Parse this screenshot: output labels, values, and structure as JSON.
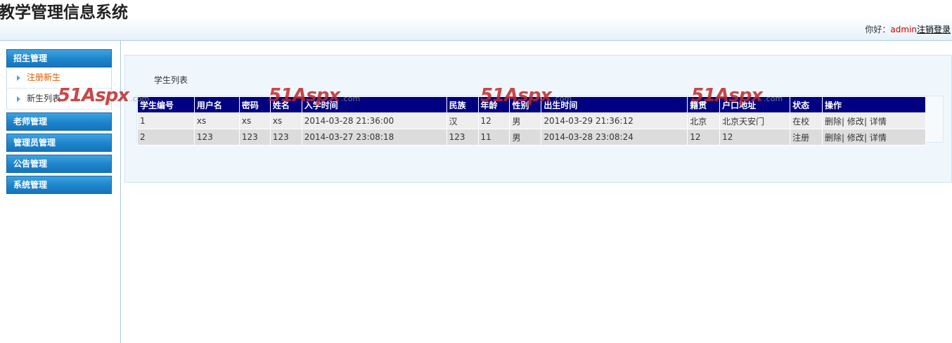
{
  "header": {
    "title": "教学管理信息系统",
    "greeting": "你好：",
    "username": "admin",
    "logout": "注销登录"
  },
  "sidebar": {
    "groups": [
      {
        "label": "招生管理",
        "items": [
          {
            "label": "注册新生",
            "active": true
          },
          {
            "label": "新生列表",
            "active": false
          }
        ]
      },
      {
        "label": "老师管理"
      },
      {
        "label": "管理员管理"
      },
      {
        "label": "公告管理"
      },
      {
        "label": "系统管理"
      }
    ]
  },
  "main": {
    "panel_title": "学生列表",
    "table": {
      "columns": [
        "学生编号",
        "用户名",
        "密码",
        "姓名",
        "入学时间",
        "民族",
        "年龄",
        "性别",
        "出生时间",
        "籍贯",
        "户口地址",
        "状态",
        "操作"
      ],
      "rows": [
        [
          "1",
          "xs",
          "xs",
          "xs",
          "2014-03-28 21:36:00",
          "汉",
          "12",
          "男",
          "2014-03-29 21:36:12",
          "北京",
          "北京天安门",
          "在校"
        ],
        [
          "2",
          "123",
          "123",
          "123",
          "2014-03-27 23:08:18",
          "123",
          "11",
          "男",
          "2014-03-28 23:08:24",
          "12",
          "12",
          "注册"
        ]
      ],
      "actions": {
        "delete": "删除",
        "edit": "修改",
        "detail": "详情",
        "sep": "|"
      }
    }
  },
  "watermark": {
    "brand": "51Aspx",
    "suffix": ".com"
  },
  "colors": {
    "table_header": "#000080",
    "menu": "#1d84cc",
    "active_item": "#e05a00",
    "username": "#cc0000"
  }
}
